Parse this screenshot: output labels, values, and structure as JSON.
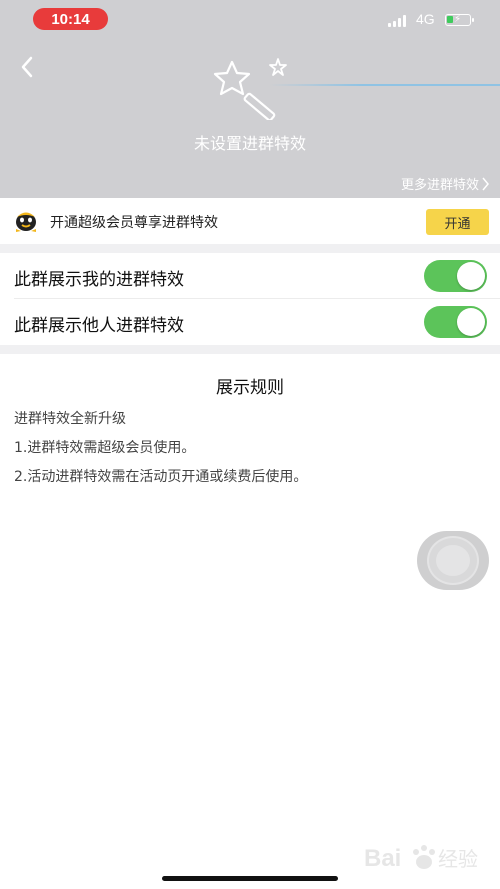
{
  "status_bar": {
    "time": "10:14",
    "network": "4G"
  },
  "header": {
    "effect_status": "未设置进群特效",
    "more_effects": "更多进群特效"
  },
  "promo": {
    "text": "开通超级会员尊享进群特效",
    "button_label": "开通"
  },
  "settings": [
    {
      "label": "此群展示我的进群特效",
      "enabled": true
    },
    {
      "label": "此群展示他人进群特效",
      "enabled": true
    }
  ],
  "rules": {
    "title": "展示规则",
    "lines": [
      "进群特效全新升级",
      "1.进群特效需超级会员使用。",
      "2.活动进群特效需在活动页开通或续费后使用。"
    ]
  },
  "colors": {
    "header_bg": "#cfcfd2",
    "toggle_on": "#5cc45a",
    "promo_button": "#f6d44a",
    "time_pill": "#e83b3b"
  },
  "watermark": "Bai经验"
}
